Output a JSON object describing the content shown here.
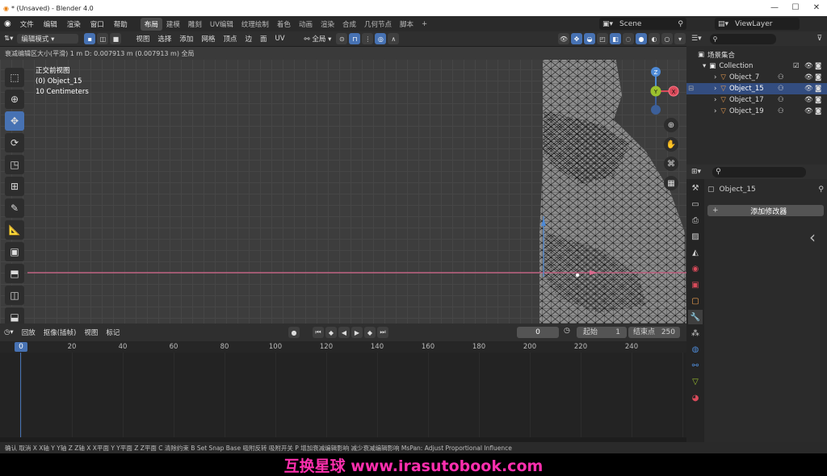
{
  "title": "* (Unsaved) - Blender 4.0",
  "window_controls": [
    "—",
    "☐",
    "✕"
  ],
  "menu": [
    "文件",
    "编辑",
    "渲染",
    "窗口",
    "帮助"
  ],
  "workspaces": [
    "布局",
    "建模",
    "雕刻",
    "UV编辑",
    "纹理绘制",
    "着色",
    "动画",
    "渲染",
    "合成",
    "几何节点",
    "脚本",
    "+"
  ],
  "scene_label": "Scene",
  "viewlayer_label": "ViewLayer",
  "viewport_header": {
    "mode": "编辑模式",
    "menus": [
      "视图",
      "选择",
      "添加",
      "网格",
      "顶点",
      "边",
      "面",
      "UV"
    ],
    "transform": "全局"
  },
  "operation_bar": "衰减编辑区大小(平滑) 1 m  D: 0.007913 m (0.007913 m) 全局",
  "overlay": {
    "line1": "正交前视图",
    "line2": "(0) Object_15",
    "line3": "10 Centimeters"
  },
  "gizmo": {
    "z": "Z",
    "y": "Y",
    "x": "X"
  },
  "timeline": {
    "menus": [
      "回放",
      "抠像(插帧)",
      "视图",
      "标记"
    ],
    "current_frame": "0",
    "start_label": "起始",
    "start": "1",
    "end_label": "结束点",
    "end": "250",
    "ruler": [
      "0",
      "20",
      "40",
      "60",
      "80",
      "100",
      "120",
      "140",
      "160",
      "180",
      "200",
      "220",
      "240"
    ]
  },
  "outliner": {
    "root": "场景集合",
    "collection": "Collection",
    "objects": [
      "Object_7",
      "Object_15",
      "Object_17",
      "Object_19"
    ]
  },
  "properties": {
    "object": "Object_15",
    "add_modifier": "添加修改器"
  },
  "status_bar": "确认  取消  X X轴  Y Y轴  Z Z轴  X X平面  Y Y平面  Z Z平面  C 清除约束  B Set Snap Base  吸附反转  吸附开关  P 增加衰减编辑影响  减少衰减编辑影响  MsPan: Adjust Proportional Influence",
  "banner": "互换星球 www.irasutobook.com"
}
